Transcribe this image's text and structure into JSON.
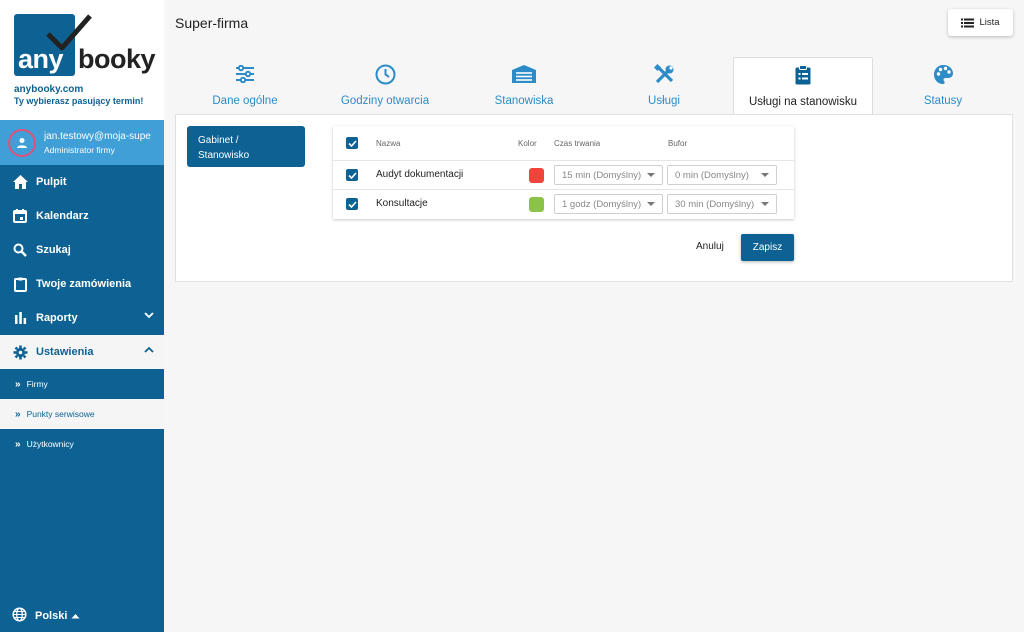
{
  "brand": {
    "logo_any": "any",
    "logo_booky": "booky",
    "url": "anybooky.com",
    "tagline": "Ty wybierasz pasujący termin!"
  },
  "user": {
    "email": "jan.testowy@moja-supe",
    "role": "Administrator firmy"
  },
  "nav": {
    "pulpit": "Pulpit",
    "kalendarz": "Kalendarz",
    "szukaj": "Szukaj",
    "zamowienia": "Twoje zamówienia",
    "raporty": "Raporty",
    "ustawienia": "Ustawienia",
    "sub_firmy": "Firmy",
    "sub_punkty": "Punkty serwisowe",
    "sub_uzytkownicy": "Użytkownicy"
  },
  "language": "Polski",
  "page_title": "Super-firma",
  "lista_label": "Lista",
  "tabs": [
    {
      "label": "Dane ogólne",
      "icon": "sliders-icon"
    },
    {
      "label": "Godziny otwarcia",
      "icon": "clock-icon"
    },
    {
      "label": "Stanowiska",
      "icon": "garage-icon"
    },
    {
      "label": "Usługi",
      "icon": "tools-icon"
    },
    {
      "label": "Usługi na stanowisku",
      "icon": "clipboard-icon"
    },
    {
      "label": "Statusy",
      "icon": "palette-icon"
    }
  ],
  "active_tab": "Usługi na stanowisku",
  "gabinet_button": {
    "line1": "Gabinet /",
    "line2": "Stanowisko"
  },
  "table": {
    "headers": {
      "name": "Nazwa",
      "color": "Kolor",
      "duration": "Czas trwania",
      "buffer": "Bufor"
    },
    "rows": [
      {
        "checked": true,
        "name": "Audyt dokumentacji",
        "color": "#f0453a",
        "duration": "15 min (Domyślny)",
        "buffer": "0 min (Domyślny)"
      },
      {
        "checked": true,
        "name": "Konsultacje",
        "color": "#8bc34a",
        "duration": "1 godz (Domyślny)",
        "buffer": "30 min (Domyślny)"
      }
    ]
  },
  "actions": {
    "cancel": "Anuluj",
    "save": "Zapisz"
  },
  "colors": {
    "primary": "#0d6293",
    "accent": "#3f9fd6",
    "tab_text": "#2c8cc8"
  }
}
